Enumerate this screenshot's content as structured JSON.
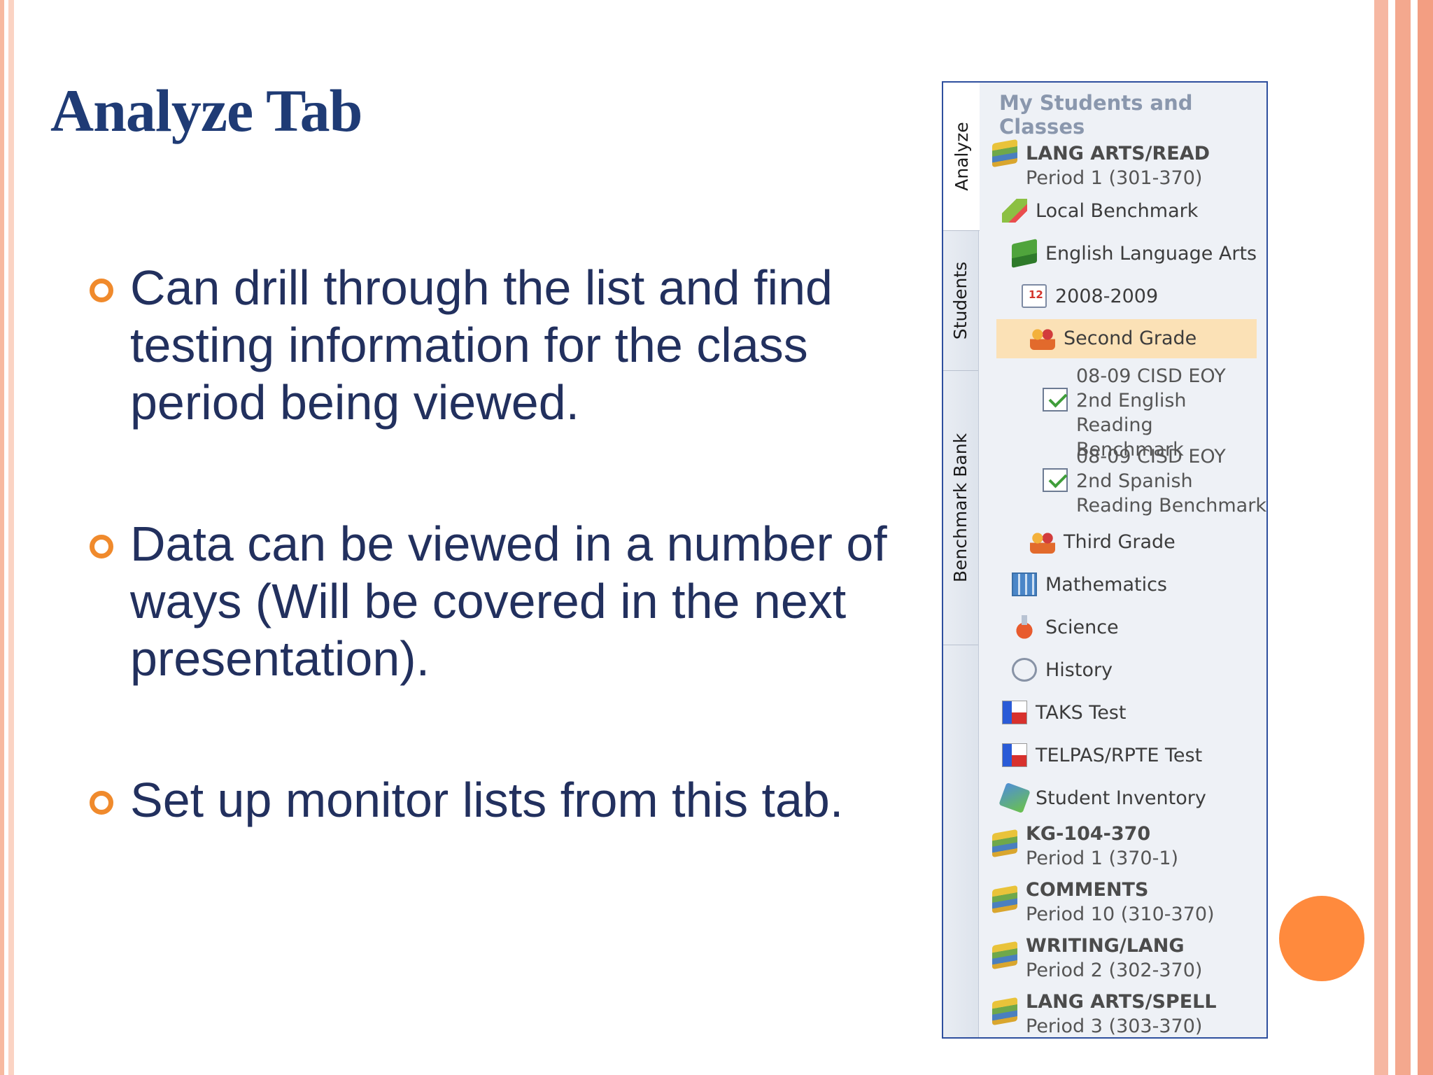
{
  "slide": {
    "title": "Analyze Tab",
    "bullets": [
      "Can drill through the list and find testing information for the class period being viewed.",
      "Data can be viewed in a number of ways (Will be covered in the next presentation).",
      "Set up monitor lists from this tab."
    ]
  },
  "panel": {
    "header": "My Students and Classes",
    "tabs": [
      "Analyze",
      "Students",
      "Benchmark Bank"
    ],
    "active_tab": "Analyze",
    "tree": [
      {
        "bold": "LANG ARTS/READ",
        "sub": "Period 1 (301-370)",
        "icon": "books-icon"
      },
      {
        "label": "Local Benchmark",
        "icon": "pencil-icon"
      },
      {
        "label": "English Language Arts",
        "icon": "green-book-icon"
      },
      {
        "label": "2008-2009",
        "icon": "calendar-icon"
      },
      {
        "label": "Second Grade",
        "icon": "people-icon",
        "selected": true
      },
      {
        "lines": [
          "08-09 CISD EOY",
          "2nd English Reading",
          "Benchmark"
        ],
        "icon": "test-note-icon"
      },
      {
        "lines": [
          "08-09 CISD EOY",
          "2nd Spanish",
          "Reading Benchmark"
        ],
        "icon": "test-note-icon"
      },
      {
        "label": "Third Grade",
        "icon": "people-icon"
      },
      {
        "label": "Mathematics",
        "icon": "calculator-icon"
      },
      {
        "label": "Science",
        "icon": "flask-icon"
      },
      {
        "label": "History",
        "icon": "globe-icon"
      },
      {
        "label": "TAKS Test",
        "icon": "texas-flag-icon"
      },
      {
        "label": "TELPAS/RPTE Test",
        "icon": "texas-flag-icon"
      },
      {
        "label": "Student Inventory",
        "icon": "inventory-icon"
      },
      {
        "bold": "KG-104-370",
        "sub": "Period 1 (370-1)",
        "icon": "books-icon"
      },
      {
        "bold": "COMMENTS",
        "sub": "Period 10 (310-370)",
        "icon": "books-icon"
      },
      {
        "bold": "WRITING/LANG",
        "sub": "Period 2 (302-370)",
        "icon": "books-icon"
      },
      {
        "bold": "LANG ARTS/SPELL",
        "sub": "Period 3 (303-370)",
        "icon": "books-icon"
      }
    ]
  },
  "colors": {
    "title": "#1f3b75",
    "bullet_text": "#22305e",
    "bullet_marker": "#f08a2c",
    "accent_dot": "#ff8a3d",
    "selection": "#fbe1b6"
  }
}
